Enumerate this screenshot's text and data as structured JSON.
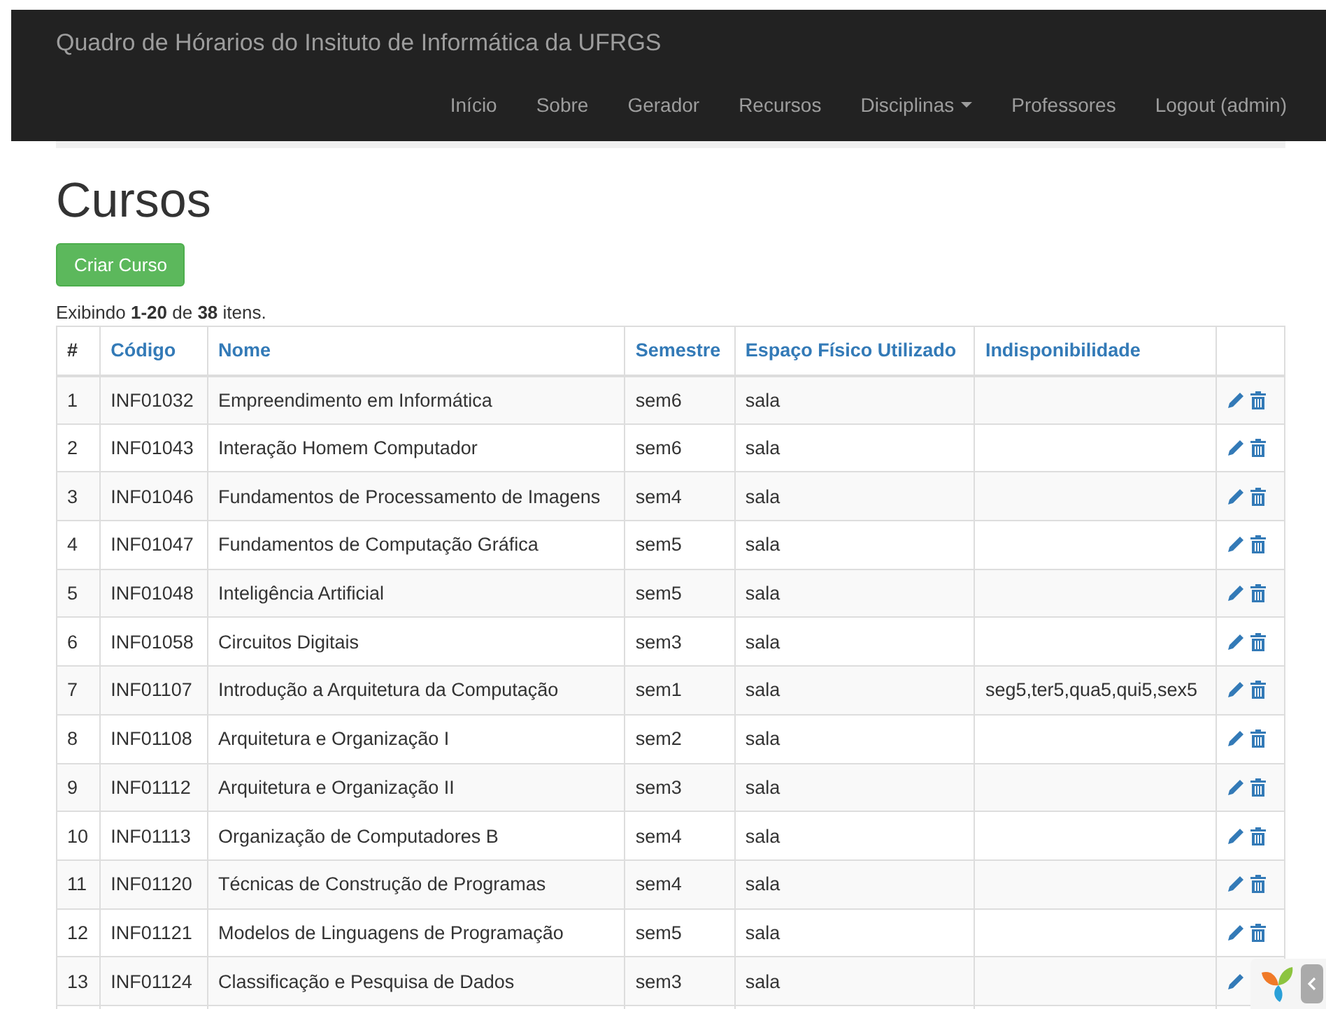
{
  "navbar": {
    "brand": "Quadro de Hórarios do Insituto de Informática da UFRGS",
    "items": [
      {
        "label": "Início",
        "kind": "link"
      },
      {
        "label": "Sobre",
        "kind": "link"
      },
      {
        "label": "Gerador",
        "kind": "link"
      },
      {
        "label": "Recursos",
        "kind": "link"
      },
      {
        "label": "Disciplinas",
        "kind": "dropdown"
      },
      {
        "label": "Professores",
        "kind": "link"
      },
      {
        "label": "Logout (admin)",
        "kind": "link"
      }
    ]
  },
  "page_title": "Cursos",
  "create_button": "Criar Curso",
  "summary": "Exibindo **1-20** de **38** itens.",
  "table": {
    "columns": [
      "#",
      "Código",
      "Nome",
      "Semestre",
      "Espaço Físico Utilizado",
      "Indisponibilidade"
    ],
    "rows": [
      [
        "1",
        "INF01032",
        "Empreendimento em Informática",
        "sem6",
        "sala",
        ""
      ],
      [
        "2",
        "INF01043",
        "Interação Homem Computador",
        "sem6",
        "sala",
        ""
      ],
      [
        "3",
        "INF01046",
        "Fundamentos de Processamento de Imagens",
        "sem4",
        "sala",
        ""
      ],
      [
        "4",
        "INF01047",
        "Fundamentos de Computação Gráfica",
        "sem5",
        "sala",
        ""
      ],
      [
        "5",
        "INF01048",
        "Inteligência Artificial",
        "sem5",
        "sala",
        ""
      ],
      [
        "6",
        "INF01058",
        "Circuitos Digitais",
        "sem3",
        "sala",
        ""
      ],
      [
        "7",
        "INF01107",
        "Introdução a Arquitetura da Computação",
        "sem1",
        "sala",
        "seg5,ter5,qua5,qui5,sex5"
      ],
      [
        "8",
        "INF01108",
        "Arquitetura e Organização I",
        "sem2",
        "sala",
        ""
      ],
      [
        "9",
        "INF01112",
        "Arquitetura e Organização II",
        "sem3",
        "sala",
        ""
      ],
      [
        "10",
        "INF01113",
        "Organização de Computadores B",
        "sem4",
        "sala",
        ""
      ],
      [
        "11",
        "INF01120",
        "Técnicas de Construção de Programas",
        "sem4",
        "sala",
        ""
      ],
      [
        "12",
        "INF01121",
        "Modelos de Linguagens de Programação",
        "sem5",
        "sala",
        ""
      ],
      [
        "13",
        "INF01124",
        "Classificação e Pesquisa de Dados",
        "sem3",
        "sala",
        ""
      ]
    ]
  }
}
